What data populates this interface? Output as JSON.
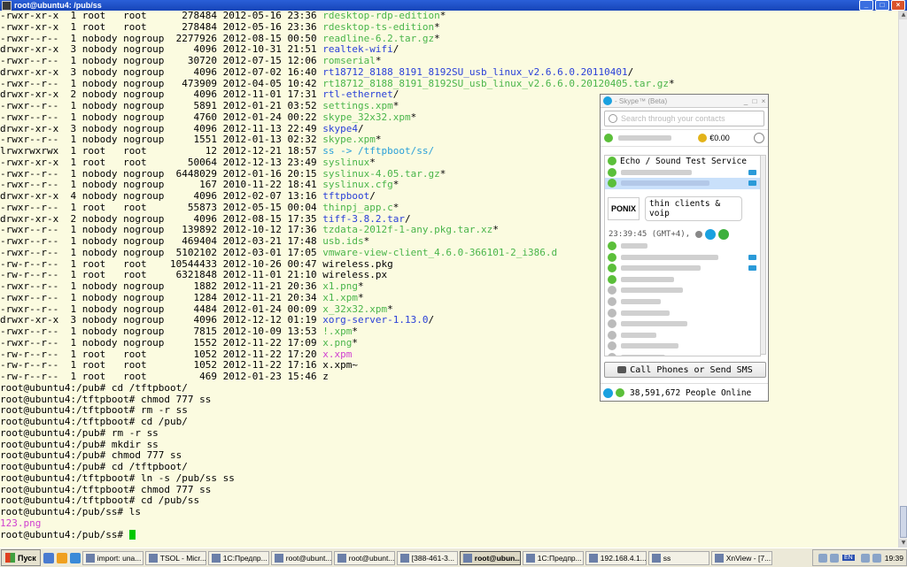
{
  "window": {
    "title": "root@ubuntu4: /pub/ss",
    "min": "_",
    "max": "□",
    "close": "×"
  },
  "colors": {
    "exec": "#4ab54a",
    "dir": "#2a40d8",
    "link": "#2aa0d8",
    "archive": "#c83232",
    "image": "#d040d0",
    "cursor": "#00c800",
    "background": "#fbfbe0"
  },
  "terminal": {
    "listing": [
      {
        "perm": "-rwxr-xr-x",
        "links": "1",
        "owner": "root",
        "group": "root",
        "size": "278484",
        "date": "2012-05-16 23:36",
        "name": "rdesktop-rdp-edition",
        "type": "exec",
        "suffix": "*"
      },
      {
        "perm": "-rwxr-xr-x",
        "links": "1",
        "owner": "root",
        "group": "root",
        "size": "278484",
        "date": "2012-05-16 23:36",
        "name": "rdesktop-ts-edition",
        "type": "exec",
        "suffix": "*"
      },
      {
        "perm": "-rwxr--r--",
        "links": "1",
        "owner": "nobody",
        "group": "nogroup",
        "size": "2277926",
        "date": "2012-08-15 00:50",
        "name": "readline-6.2.tar.gz",
        "type": "exec",
        "suffix": "*"
      },
      {
        "perm": "drwxr-xr-x",
        "links": "3",
        "owner": "nobody",
        "group": "nogroup",
        "size": "4096",
        "date": "2012-10-31 21:51",
        "name": "realtek-wifi",
        "type": "dir",
        "suffix": "/"
      },
      {
        "perm": "-rwxr--r--",
        "links": "1",
        "owner": "nobody",
        "group": "nogroup",
        "size": "30720",
        "date": "2012-07-15 12:06",
        "name": "romserial",
        "type": "exec",
        "suffix": "*"
      },
      {
        "perm": "drwxr-xr-x",
        "links": "3",
        "owner": "nobody",
        "group": "nogroup",
        "size": "4096",
        "date": "2012-07-02 16:40",
        "name": "rt18712_8188_8191_8192SU_usb_linux_v2.6.6.0.20110401",
        "type": "dir",
        "suffix": "/"
      },
      {
        "perm": "-rwxr--r--",
        "links": "1",
        "owner": "nobody",
        "group": "nogroup",
        "size": "473909",
        "date": "2012-04-05 10:42",
        "name": "rt18712_8188_8191_8192SU_usb_linux_v2.6.6.0.20120405.tar.gz",
        "type": "exec",
        "suffix": "*"
      },
      {
        "perm": "drwxr-xr-x",
        "links": "2",
        "owner": "nobody",
        "group": "nogroup",
        "size": "4096",
        "date": "2012-11-01 17:31",
        "name": "rtl-ethernet",
        "type": "dir",
        "suffix": "/"
      },
      {
        "perm": "-rwxr--r--",
        "links": "1",
        "owner": "nobody",
        "group": "nogroup",
        "size": "5891",
        "date": "2012-01-21 03:52",
        "name": "settings.xpm",
        "type": "exec",
        "suffix": "*"
      },
      {
        "perm": "-rwxr--r--",
        "links": "1",
        "owner": "nobody",
        "group": "nogroup",
        "size": "4760",
        "date": "2012-01-24 00:22",
        "name": "skype_32x32.xpm",
        "type": "exec",
        "suffix": "*"
      },
      {
        "perm": "drwxr-xr-x",
        "links": "3",
        "owner": "nobody",
        "group": "nogroup",
        "size": "4096",
        "date": "2012-11-13 22:49",
        "name": "skype4",
        "type": "dir",
        "suffix": "/"
      },
      {
        "perm": "-rwxr--r--",
        "links": "1",
        "owner": "nobody",
        "group": "nogroup",
        "size": "1551",
        "date": "2012-01-13 02:32",
        "name": "skype.xpm",
        "type": "exec",
        "suffix": "*"
      },
      {
        "perm": "lrwxrwxrwx",
        "links": "1",
        "owner": "root",
        "group": "root",
        "size": "12",
        "date": "2012-12-21 18:57",
        "name": "ss",
        "type": "link",
        "suffix": " -> /tftpboot/ss/"
      },
      {
        "perm": "-rwxr-xr-x",
        "links": "1",
        "owner": "root",
        "group": "root",
        "size": "50064",
        "date": "2012-12-13 23:49",
        "name": "syslinux",
        "type": "exec",
        "suffix": "*"
      },
      {
        "perm": "-rwxr--r--",
        "links": "1",
        "owner": "nobody",
        "group": "nogroup",
        "size": "6448029",
        "date": "2012-01-16 20:15",
        "name": "syslinux-4.05.tar.gz",
        "type": "exec",
        "suffix": "*"
      },
      {
        "perm": "-rwxr--r--",
        "links": "1",
        "owner": "nobody",
        "group": "nogroup",
        "size": "167",
        "date": "2010-11-22 18:41",
        "name": "syslinux.cfg",
        "type": "exec",
        "suffix": "*"
      },
      {
        "perm": "drwxr-xr-x",
        "links": "4",
        "owner": "nobody",
        "group": "nogroup",
        "size": "4096",
        "date": "2012-02-07 13:16",
        "name": "tftpboot",
        "type": "dir",
        "suffix": "/"
      },
      {
        "perm": "-rwxr--r--",
        "links": "1",
        "owner": "root",
        "group": "root",
        "size": "55873",
        "date": "2012-05-15 00:04",
        "name": "thinpj_app.c",
        "type": "exec",
        "suffix": "*"
      },
      {
        "perm": "drwxr-xr-x",
        "links": "2",
        "owner": "nobody",
        "group": "nogroup",
        "size": "4096",
        "date": "2012-08-15 17:35",
        "name": "tiff-3.8.2.tar",
        "type": "dir",
        "suffix": "/"
      },
      {
        "perm": "-rwxr--r--",
        "links": "1",
        "owner": "nobody",
        "group": "nogroup",
        "size": "139892",
        "date": "2012-10-12 17:36",
        "name": "tzdata-2012f-1-any.pkg.tar.xz",
        "type": "exec",
        "suffix": "*"
      },
      {
        "perm": "-rwxr--r--",
        "links": "1",
        "owner": "nobody",
        "group": "nogroup",
        "size": "469404",
        "date": "2012-03-21 17:48",
        "name": "usb.ids",
        "type": "exec",
        "suffix": "*"
      },
      {
        "perm": "-rwxr--r--",
        "links": "1",
        "owner": "nobody",
        "group": "nogroup",
        "size": "5102102",
        "date": "2012-03-01 17:05",
        "name": "vmware-view-client_4.6.0-366101-2_i386.d",
        "type": "exec",
        "suffix": ""
      },
      {
        "perm": "-rw-r--r--",
        "links": "1",
        "owner": "root",
        "group": "root",
        "size": "10544433",
        "date": "2012-10-26 00:47",
        "name": "wireless.pkg",
        "type": "plain",
        "suffix": ""
      },
      {
        "perm": "-rw-r--r--",
        "links": "1",
        "owner": "root",
        "group": "root",
        "size": "6321848",
        "date": "2012-11-01 21:10",
        "name": "wireless.px",
        "type": "plain",
        "suffix": ""
      },
      {
        "perm": "-rwxr--r--",
        "links": "1",
        "owner": "nobody",
        "group": "nogroup",
        "size": "1882",
        "date": "2012-11-21 20:36",
        "name": "x1.png",
        "type": "exec",
        "suffix": "*"
      },
      {
        "perm": "-rwxr--r--",
        "links": "1",
        "owner": "nobody",
        "group": "nogroup",
        "size": "1284",
        "date": "2012-11-21 20:34",
        "name": "x1.xpm",
        "type": "exec",
        "suffix": "*"
      },
      {
        "perm": "-rwxr--r--",
        "links": "1",
        "owner": "nobody",
        "group": "nogroup",
        "size": "4484",
        "date": "2012-01-24 00:09",
        "name": "x_32x32.xpm",
        "type": "exec",
        "suffix": "*"
      },
      {
        "perm": "drwxr-xr-x",
        "links": "3",
        "owner": "nobody",
        "group": "nogroup",
        "size": "4096",
        "date": "2012-12-12 01:19",
        "name": "xorg-server-1.13.0",
        "type": "dir",
        "suffix": "/"
      },
      {
        "perm": "-rwxr--r--",
        "links": "1",
        "owner": "nobody",
        "group": "nogroup",
        "size": "7815",
        "date": "2012-10-09 13:53",
        "name": "!.xpm",
        "type": "exec",
        "suffix": "*"
      },
      {
        "perm": "-rwxr--r--",
        "links": "1",
        "owner": "nobody",
        "group": "nogroup",
        "size": "1552",
        "date": "2012-11-22 17:09",
        "name": "x.png",
        "type": "exec",
        "suffix": "*"
      },
      {
        "perm": "-rw-r--r--",
        "links": "1",
        "owner": "root",
        "group": "root",
        "size": "1052",
        "date": "2012-11-22 17:20",
        "name": "x.xpm",
        "type": "image",
        "suffix": ""
      },
      {
        "perm": "-rw-r--r--",
        "links": "1",
        "owner": "root",
        "group": "root",
        "size": "1052",
        "date": "2012-11-22 17:16",
        "name": "x.xpm~",
        "type": "plain",
        "suffix": ""
      },
      {
        "perm": "-rw-r--r--",
        "links": "1",
        "owner": "root",
        "group": "root",
        "size": "469",
        "date": "2012-01-23 15:46",
        "name": "z",
        "type": "plain",
        "suffix": ""
      }
    ],
    "commands": [
      "root@ubuntu4:/pub# cd /tftpboot/",
      "root@ubuntu4:/tftpboot# chmod 777 ss",
      "root@ubuntu4:/tftpboot# rm -r ss",
      "root@ubuntu4:/tftpboot# cd /pub/",
      "root@ubuntu4:/pub# rm -r ss",
      "root@ubuntu4:/pub# mkdir ss",
      "root@ubuntu4:/pub# chmod 777 ss",
      "root@ubuntu4:/pub# cd /tftpboot/",
      "root@ubuntu4:/tftpboot# ln -s /pub/ss ss",
      "root@ubuntu4:/tftpboot# chmod 777 ss",
      "root@ubuntu4:/tftpboot# cd /pub/ss",
      "root@ubuntu4:/pub/ss# ls"
    ],
    "ls_output": "123.png",
    "prompt": "root@ubuntu4:/pub/ss# "
  },
  "skype": {
    "title": "- Skype™ (Beta)",
    "search_placeholder": "Search through your contacts",
    "balance": "€0.00",
    "group_label": "Echo / Sound Test Service",
    "card_logo": "PONIX",
    "card_text": "thin clients & voip",
    "card_time": "23:39:45 (GMT+4),",
    "call_button": "Call Phones or Send SMS",
    "online_count": "38,591,672 People Online"
  },
  "taskbar": {
    "start": "Пуск",
    "items": [
      {
        "label": "import: una...",
        "active": false
      },
      {
        "label": "TSOL - Micr...",
        "active": false
      },
      {
        "label": "1С:Предпр...",
        "active": false
      },
      {
        "label": "root@ubunt...",
        "active": false
      },
      {
        "label": "root@ubunt...",
        "active": false
      },
      {
        "label": "[388-461-3...",
        "active": false
      },
      {
        "label": "root@ubun...",
        "active": true
      },
      {
        "label": "1С:Предпр...",
        "active": false
      },
      {
        "label": "192.168.4.1...",
        "active": false
      },
      {
        "label": "ss",
        "active": false
      },
      {
        "label": "XnView - [7....",
        "active": false
      }
    ],
    "lang": "EN",
    "clock": "19:39"
  }
}
